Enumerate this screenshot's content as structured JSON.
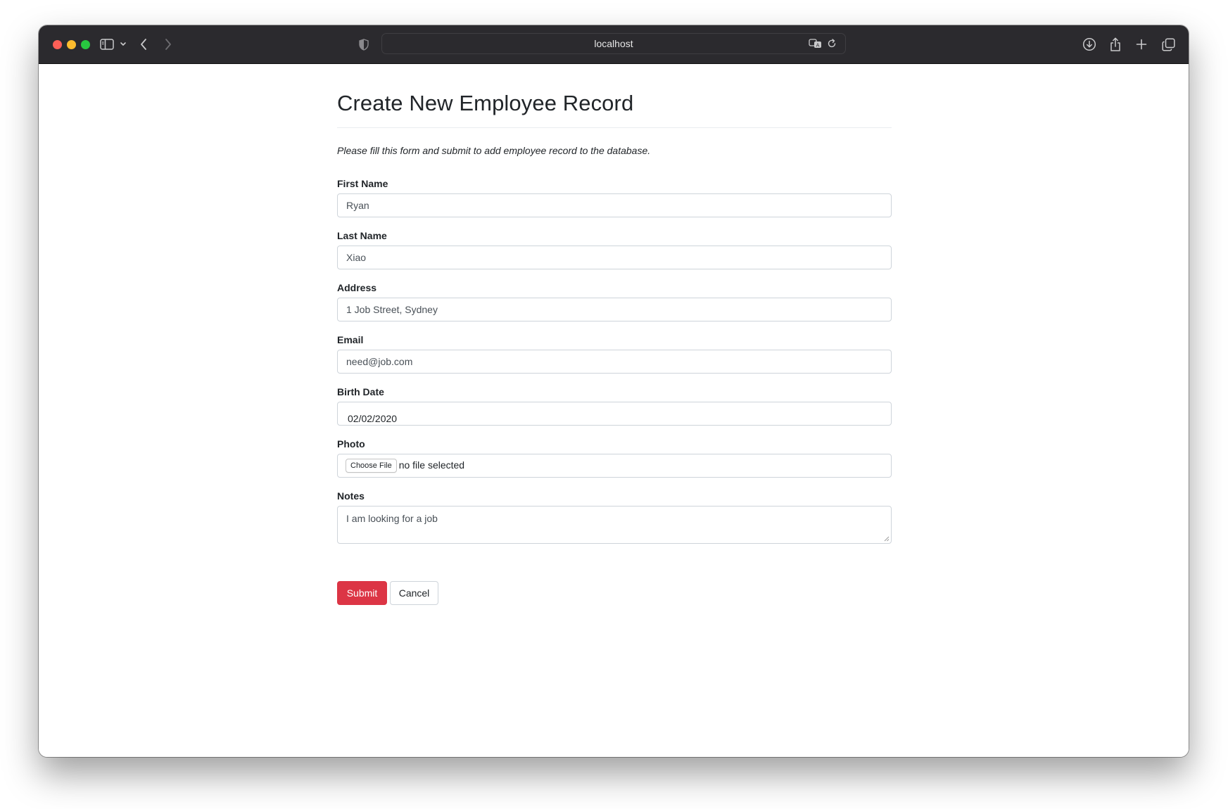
{
  "browser": {
    "url": "localhost"
  },
  "page": {
    "title": "Create New Employee Record",
    "intro": "Please fill this form and submit to add employee record to the database."
  },
  "form": {
    "first_name": {
      "label": "First Name",
      "value": "Ryan"
    },
    "last_name": {
      "label": "Last Name",
      "value": "Xiao"
    },
    "address": {
      "label": "Address",
      "value": "1 Job Street, Sydney"
    },
    "email": {
      "label": "Email",
      "value": "need@job.com"
    },
    "birth_date": {
      "label": "Birth Date",
      "value": "02/02/2020"
    },
    "photo": {
      "label": "Photo",
      "button_label": "Choose File",
      "status": "no file selected"
    },
    "notes": {
      "label": "Notes",
      "value": "I am looking for a job"
    },
    "submit_label": "Submit",
    "cancel_label": "Cancel"
  },
  "colors": {
    "submit_button": "#dc3545",
    "titlebar": "#2b2a2e",
    "close_light": "#fe5f57",
    "minimize_light": "#febc2e",
    "zoom_light": "#28c840"
  }
}
